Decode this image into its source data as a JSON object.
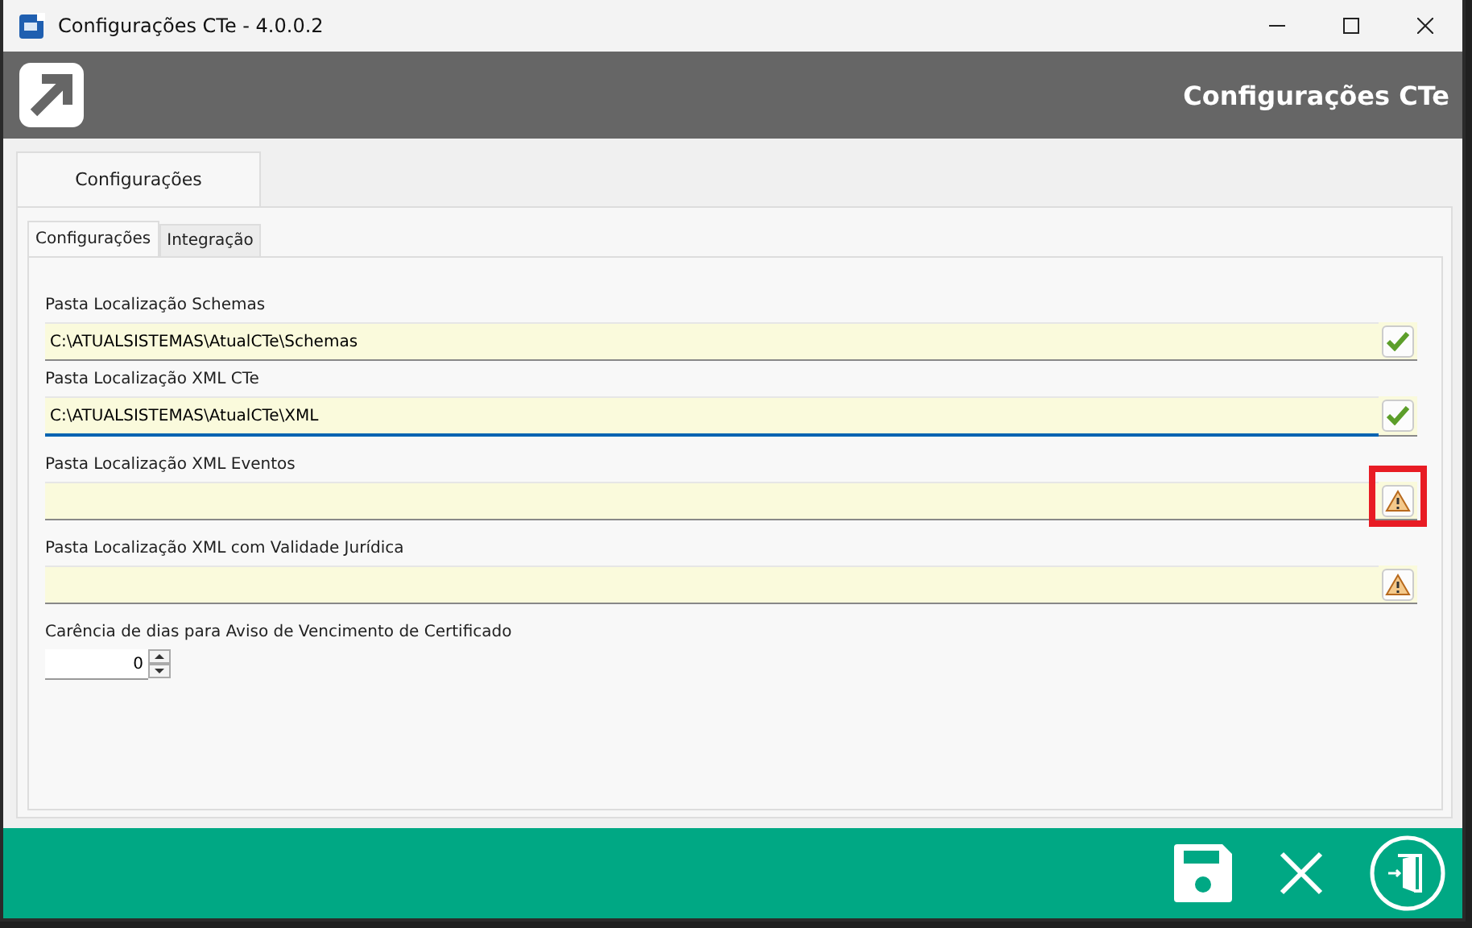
{
  "window": {
    "title": "Configurações CTe - 4.0.0.2"
  },
  "header": {
    "title": "Configurações CTe"
  },
  "outer_tabs": [
    {
      "label": "Configurações",
      "selected": true
    }
  ],
  "inner_tabs": [
    {
      "label": "Configurações",
      "selected": true
    },
    {
      "label": "Integração",
      "selected": false
    }
  ],
  "fields": [
    {
      "label": "Pasta Localização Schemas",
      "value": "C:\\ATUALSISTEMAS\\AtualCTe\\Schemas",
      "kind": "valid",
      "focused": false,
      "highlighted": false
    },
    {
      "label": "Pasta Localização XML CTe",
      "value": "C:\\ATUALSISTEMAS\\AtualCTe\\XML",
      "kind": "valid",
      "focused": true,
      "highlighted": false
    },
    {
      "label": "Pasta Localização XML Eventos",
      "kind": "warning",
      "focused": false,
      "highlighted": true
    },
    {
      "label": "Pasta Localização XML com Validade Jurídica",
      "kind": "warning",
      "focused": false,
      "highlighted": false
    }
  ],
  "spinner": {
    "label": "Carência de dias para Aviso de Vencimento de Certificado",
    "value": "0"
  }
}
